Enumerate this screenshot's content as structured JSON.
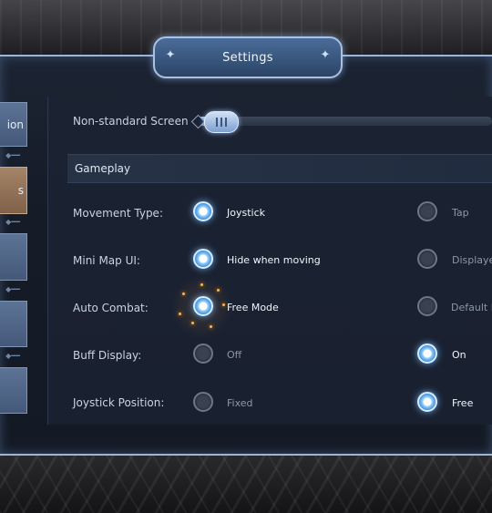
{
  "title": "Settings",
  "tabs": [
    {
      "label": "ion",
      "active": false
    },
    {
      "label": "s",
      "active": true
    },
    {
      "label": "",
      "active": false
    },
    {
      "label": "",
      "active": false
    },
    {
      "label": "",
      "active": false
    }
  ],
  "screen": {
    "label": "Non-standard Screen",
    "value_fraction": 0.1
  },
  "section": {
    "title": "Gameplay"
  },
  "settings": [
    {
      "label": "Movement Type:",
      "option1": "Joystick",
      "option2": "Tap",
      "selected": 1
    },
    {
      "label": "Mini Map UI:",
      "option1": "Hide when moving",
      "option2": "Displayed",
      "selected": 1
    },
    {
      "label": "Auto Combat:",
      "option1": "Free Mode",
      "option2": "Default M",
      "selected": 1
    },
    {
      "label": "Buff Display:",
      "option1": "Off",
      "option2": "On",
      "selected": 2
    },
    {
      "label": "Joystick Position:",
      "option1": "Fixed",
      "option2": "Free",
      "selected": 2
    }
  ],
  "colors": {
    "accent": "#9db5d6",
    "active_tab": "#a58468",
    "radio_on": "#3f8fd9"
  }
}
